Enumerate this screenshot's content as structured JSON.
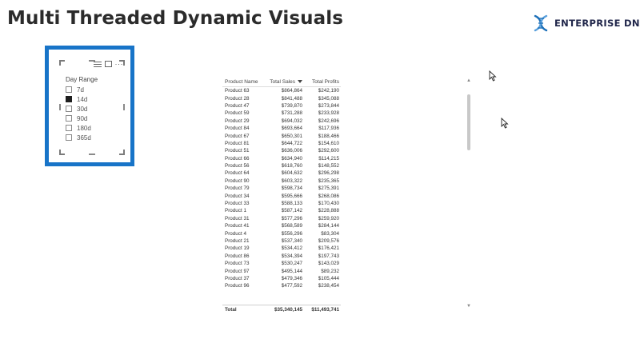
{
  "title": "Multi Threaded Dynamic Visuals",
  "brand": {
    "name": "ENTERPRISE DNA",
    "icon": "dna-helix-icon",
    "color": "#1b6fb8"
  },
  "slicer": {
    "title": "Day Range",
    "accent": "#1874c8",
    "options": [
      {
        "label": "7d",
        "checked": false
      },
      {
        "label": "14d",
        "checked": true
      },
      {
        "label": "30d",
        "checked": false
      },
      {
        "label": "90d",
        "checked": false
      },
      {
        "label": "180d",
        "checked": false
      },
      {
        "label": "365d",
        "checked": false
      }
    ]
  },
  "table": {
    "columns": [
      "Product Name",
      "Total Sales",
      "Total Profits"
    ],
    "rows": [
      [
        "Product 63",
        "$864,864",
        "$242,190"
      ],
      [
        "Product 28",
        "$841,488",
        "$345,088"
      ],
      [
        "Product 47",
        "$739,870",
        "$273,844"
      ],
      [
        "Product 59",
        "$731,288",
        "$233,928"
      ],
      [
        "Product 29",
        "$694,032",
        "$242,696"
      ],
      [
        "Product 84",
        "$693,664",
        "$117,936"
      ],
      [
        "Product 67",
        "$650,301",
        "$188,466"
      ],
      [
        "Product 81",
        "$644,722",
        "$154,610"
      ],
      [
        "Product 51",
        "$636,006",
        "$292,600"
      ],
      [
        "Product 66",
        "$634,940",
        "$114,215"
      ],
      [
        "Product 56",
        "$618,760",
        "$148,552"
      ],
      [
        "Product 64",
        "$604,632",
        "$296,298"
      ],
      [
        "Product 90",
        "$603,322",
        "$235,365"
      ],
      [
        "Product 79",
        "$598,734",
        "$275,391"
      ],
      [
        "Product 34",
        "$595,666",
        "$268,086"
      ],
      [
        "Product 33",
        "$588,133",
        "$170,430"
      ],
      [
        "Product 1",
        "$587,142",
        "$228,888"
      ],
      [
        "Product 31",
        "$577,296",
        "$259,920"
      ],
      [
        "Product 41",
        "$568,589",
        "$284,144"
      ],
      [
        "Product 4",
        "$556,296",
        "$83,304"
      ],
      [
        "Product 21",
        "$537,340",
        "$209,576"
      ],
      [
        "Product 19",
        "$534,412",
        "$176,421"
      ],
      [
        "Product 86",
        "$534,394",
        "$197,743"
      ],
      [
        "Product 73",
        "$530,247",
        "$143,029"
      ],
      [
        "Product 97",
        "$495,144",
        "$89,232"
      ],
      [
        "Product 37",
        "$479,346",
        "$105,444"
      ],
      [
        "Product 96",
        "$477,592",
        "$238,454"
      ]
    ],
    "total": [
      "Total",
      "$35,340,145",
      "$11,493,741"
    ]
  }
}
